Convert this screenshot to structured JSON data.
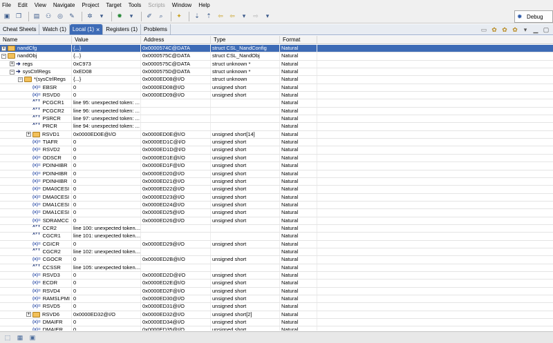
{
  "menubar": {
    "items": [
      {
        "label": "File"
      },
      {
        "label": "Edit"
      },
      {
        "label": "View"
      },
      {
        "label": "Navigate"
      },
      {
        "label": "Project"
      },
      {
        "label": "Target"
      },
      {
        "label": "Tools"
      },
      {
        "label": "Scripts",
        "disabled": true
      },
      {
        "label": "Window"
      },
      {
        "label": "Help"
      }
    ]
  },
  "toolbar": {
    "perspective_label": "Debug"
  },
  "tabs": [
    {
      "label": "Cheat Sheets"
    },
    {
      "label": "Watch (1)"
    },
    {
      "label": "Local (1)",
      "active": true
    },
    {
      "label": "Registers (1)"
    },
    {
      "label": "Problems"
    }
  ],
  "columns": {
    "name": "Name",
    "value": "Value",
    "address": "Address",
    "type": "Type",
    "format": "Format"
  },
  "rows": [
    {
      "indent": 0,
      "exp": "+",
      "icon": "struct",
      "name": "nandCfg",
      "value": "{...}",
      "address": "0x0000574C@DATA",
      "type": "struct CSL_NandConfig",
      "format": "Natural",
      "selected": true
    },
    {
      "indent": 0,
      "exp": "-",
      "icon": "struct",
      "name": "nandObj",
      "value": "{...}",
      "address": "0x0000575C@DATA",
      "type": "struct CSL_NandObj",
      "format": "Natural"
    },
    {
      "indent": 1,
      "exp": "+",
      "icon": "arrow",
      "name": "regs",
      "value": "0xC973",
      "address": "0x0000575C@DATA",
      "type": "struct unknown *",
      "format": "Natural"
    },
    {
      "indent": 1,
      "exp": "-",
      "icon": "arrow",
      "name": "sysCtrlRegs",
      "value": "0xED08",
      "address": "0x0000575D@DATA",
      "type": "struct unknown *",
      "format": "Natural"
    },
    {
      "indent": 2,
      "exp": "-",
      "icon": "struct",
      "name": "*(sysCtrlRegs",
      "value": "{...}",
      "address": "0x0000ED08@I/O",
      "type": "struct unknown",
      "format": "Natural"
    },
    {
      "indent": 3,
      "exp": "",
      "icon": "var",
      "name": "EBSR",
      "value": "0",
      "address": "0x0000ED08@I/O",
      "type": "unsigned short",
      "format": "Natural"
    },
    {
      "indent": 3,
      "exp": "",
      "icon": "var",
      "name": "RSVD0",
      "value": "0",
      "address": "0x0000ED09@I/O",
      "type": "unsigned short",
      "format": "Natural"
    },
    {
      "indent": 3,
      "exp": "",
      "icon": "xy",
      "name": "PCGCR1",
      "value": "line 95: unexpected token: ...",
      "address": "",
      "type": "",
      "format": "Natural"
    },
    {
      "indent": 3,
      "exp": "",
      "icon": "xy",
      "name": "PCGCR2",
      "value": "line 96: unexpected token: ...",
      "address": "",
      "type": "",
      "format": "Natural"
    },
    {
      "indent": 3,
      "exp": "",
      "icon": "xy",
      "name": "PSRCR",
      "value": "line 97: unexpected token: ...",
      "address": "",
      "type": "",
      "format": "Natural"
    },
    {
      "indent": 3,
      "exp": "",
      "icon": "xy",
      "name": "PRCR",
      "value": "line 94: unexpected token: ...",
      "address": "",
      "type": "",
      "format": "Natural"
    },
    {
      "indent": 3,
      "exp": "+",
      "icon": "struct",
      "name": "RSVD1",
      "value": "0x0000ED0E@I/O",
      "address": "0x0000ED0E@I/O",
      "type": "unsigned short[14]",
      "format": "Natural"
    },
    {
      "indent": 3,
      "exp": "",
      "icon": "var",
      "name": "TIAFR",
      "value": "0",
      "address": "0x0000ED1C@I/O",
      "type": "unsigned short",
      "format": "Natural"
    },
    {
      "indent": 3,
      "exp": "",
      "icon": "var",
      "name": "RSVD2",
      "value": "0",
      "address": "0x0000ED1D@I/O",
      "type": "unsigned short",
      "format": "Natural"
    },
    {
      "indent": 3,
      "exp": "",
      "icon": "var",
      "name": "ODSCR",
      "value": "0",
      "address": "0x0000ED1E@I/O",
      "type": "unsigned short",
      "format": "Natural"
    },
    {
      "indent": 3,
      "exp": "",
      "icon": "var",
      "name": "PDINHIBR",
      "value": "0",
      "address": "0x0000ED1F@I/O",
      "type": "unsigned short",
      "format": "Natural"
    },
    {
      "indent": 3,
      "exp": "",
      "icon": "var",
      "name": "PDINHIBR",
      "value": "0",
      "address": "0x0000ED20@I/O",
      "type": "unsigned short",
      "format": "Natural"
    },
    {
      "indent": 3,
      "exp": "",
      "icon": "var",
      "name": "PDINHIBR",
      "value": "0",
      "address": "0x0000ED21@I/O",
      "type": "unsigned short",
      "format": "Natural"
    },
    {
      "indent": 3,
      "exp": "",
      "icon": "var",
      "name": "DMA0CESI",
      "value": "0",
      "address": "0x0000ED22@I/O",
      "type": "unsigned short",
      "format": "Natural"
    },
    {
      "indent": 3,
      "exp": "",
      "icon": "var",
      "name": "DMA0CESI",
      "value": "0",
      "address": "0x0000ED23@I/O",
      "type": "unsigned short",
      "format": "Natural"
    },
    {
      "indent": 3,
      "exp": "",
      "icon": "var",
      "name": "DMA1CESI",
      "value": "0",
      "address": "0x0000ED24@I/O",
      "type": "unsigned short",
      "format": "Natural"
    },
    {
      "indent": 3,
      "exp": "",
      "icon": "var",
      "name": "DMA1CESI",
      "value": "0",
      "address": "0x0000ED25@I/O",
      "type": "unsigned short",
      "format": "Natural"
    },
    {
      "indent": 3,
      "exp": "",
      "icon": "var",
      "name": "SDRAMCC",
      "value": "0",
      "address": "0x0000ED26@I/O",
      "type": "unsigned short",
      "format": "Natural"
    },
    {
      "indent": 3,
      "exp": "",
      "icon": "xy",
      "name": "CCR2",
      "value": "line 100: unexpected token....",
      "address": "",
      "type": "",
      "format": "Natural"
    },
    {
      "indent": 3,
      "exp": "",
      "icon": "xy",
      "name": "CGCR1",
      "value": "line 101: unexpected token....",
      "address": "",
      "type": "",
      "format": "Natural"
    },
    {
      "indent": 3,
      "exp": "",
      "icon": "var",
      "name": "CGICR",
      "value": "0",
      "address": "0x0000ED29@I/O",
      "type": "unsigned short",
      "format": "Natural"
    },
    {
      "indent": 3,
      "exp": "",
      "icon": "xy",
      "name": "CGCR2",
      "value": "line 102: unexpected token....",
      "address": "",
      "type": "",
      "format": "Natural"
    },
    {
      "indent": 3,
      "exp": "",
      "icon": "var",
      "name": "CGOCR",
      "value": "0",
      "address": "0x0000ED2B@I/O",
      "type": "unsigned short",
      "format": "Natural"
    },
    {
      "indent": 3,
      "exp": "",
      "icon": "xy",
      "name": "CCSSR",
      "value": "line 105: unexpected token....",
      "address": "",
      "type": "",
      "format": "Natural"
    },
    {
      "indent": 3,
      "exp": "",
      "icon": "var",
      "name": "RSVD3",
      "value": "0",
      "address": "0x0000ED2D@I/O",
      "type": "unsigned short",
      "format": "Natural"
    },
    {
      "indent": 3,
      "exp": "",
      "icon": "var",
      "name": "ECDR",
      "value": "0",
      "address": "0x0000ED2E@I/O",
      "type": "unsigned short",
      "format": "Natural"
    },
    {
      "indent": 3,
      "exp": "",
      "icon": "var",
      "name": "RSVD4",
      "value": "0",
      "address": "0x0000ED2F@I/O",
      "type": "unsigned short",
      "format": "Natural"
    },
    {
      "indent": 3,
      "exp": "",
      "icon": "var",
      "name": "RAMSLPMI",
      "value": "0",
      "address": "0x0000ED30@I/O",
      "type": "unsigned short",
      "format": "Natural"
    },
    {
      "indent": 3,
      "exp": "",
      "icon": "var",
      "name": "RSVD5",
      "value": "0",
      "address": "0x0000ED31@I/O",
      "type": "unsigned short",
      "format": "Natural"
    },
    {
      "indent": 3,
      "exp": "+",
      "icon": "struct",
      "name": "RSVD6",
      "value": "0x0000ED32@I/O",
      "address": "0x0000ED32@I/O",
      "type": "unsigned short[2]",
      "format": "Natural"
    },
    {
      "indent": 3,
      "exp": "",
      "icon": "var",
      "name": "DMAIFR",
      "value": "0",
      "address": "0x0000ED34@I/O",
      "type": "unsigned short",
      "format": "Natural"
    },
    {
      "indent": 3,
      "exp": "",
      "icon": "var",
      "name": "DMAIER",
      "value": "0",
      "address": "0x0000ED35@I/O",
      "type": "unsigned short",
      "format": "Natural"
    }
  ],
  "colors": {
    "selection": "#3d6bb6",
    "active_tab": "#3d6bb6",
    "struct_icon": "#f2c05a"
  }
}
